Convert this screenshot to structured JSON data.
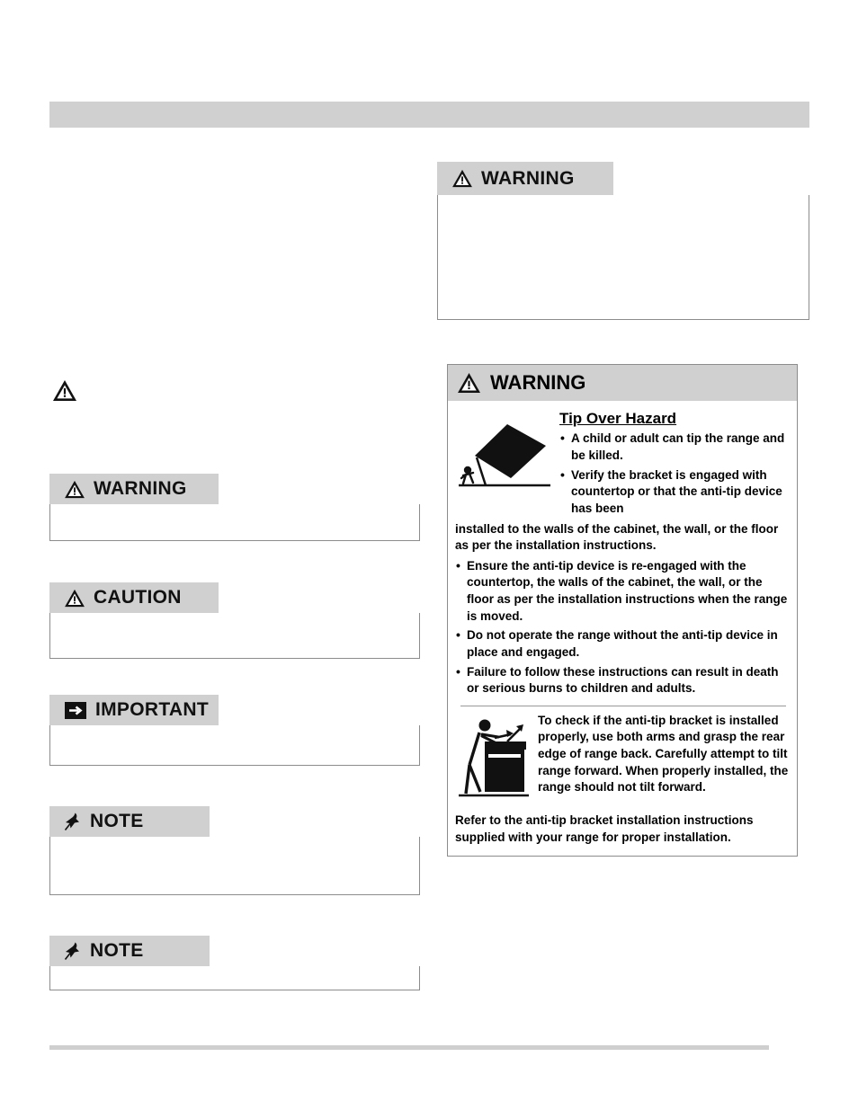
{
  "page": {
    "top_banner": "",
    "bottom_rule": ""
  },
  "left_column": {
    "standalone_icon": "warning-triangle-icon",
    "boxes": [
      {
        "icon": "warning-triangle-icon",
        "label": "WARNING",
        "body": ""
      },
      {
        "icon": "warning-triangle-icon",
        "label": "CAUTION",
        "body": ""
      },
      {
        "icon": "arrow-right-icon",
        "label": "IMPORTANT",
        "body": ""
      },
      {
        "icon": "push-pin-icon",
        "label": "NOTE",
        "body": ""
      },
      {
        "icon": "push-pin-icon",
        "label": "NOTE",
        "body": ""
      }
    ]
  },
  "right_column": {
    "empty_warning": {
      "icon": "warning-triangle-icon",
      "label": "WARNING",
      "body": ""
    },
    "tip_over": {
      "icon": "warning-triangle-icon",
      "label": "WARNING",
      "title": "Tip Over Hazard",
      "illustration_top": "range-tipping-over-icon",
      "bullets_top": [
        "A child or adult can tip the range and be killed.",
        "Verify the bracket is engaged with countertop or that the anti-tip device has been"
      ],
      "continuation": "installed to the walls of the cabinet, the wall, or the floor as per the installation instructions.",
      "bullets": [
        "Ensure the anti-tip device is re-engaged with the countertop, the walls of the cabinet, the wall, or the floor as per the installation instructions when the range is moved.",
        "Do not operate the range without the anti-tip device in place and engaged.",
        "Failure to follow these instructions can result in death or serious burns to children and adults."
      ],
      "illustration_check": "person-tilting-range-icon",
      "check_text": "To check if the anti-tip bracket is installed properly, use both arms and grasp the rear edge of range back. Carefully attempt to tilt range forward. When properly installed, the range should not tilt forward.",
      "footer": "Refer to the anti-tip bracket installation instructions supplied with your range for proper installation."
    }
  },
  "colors": {
    "header_gray": "#d0d0d0",
    "border_gray": "#8c8c8c",
    "text": "#000000"
  }
}
